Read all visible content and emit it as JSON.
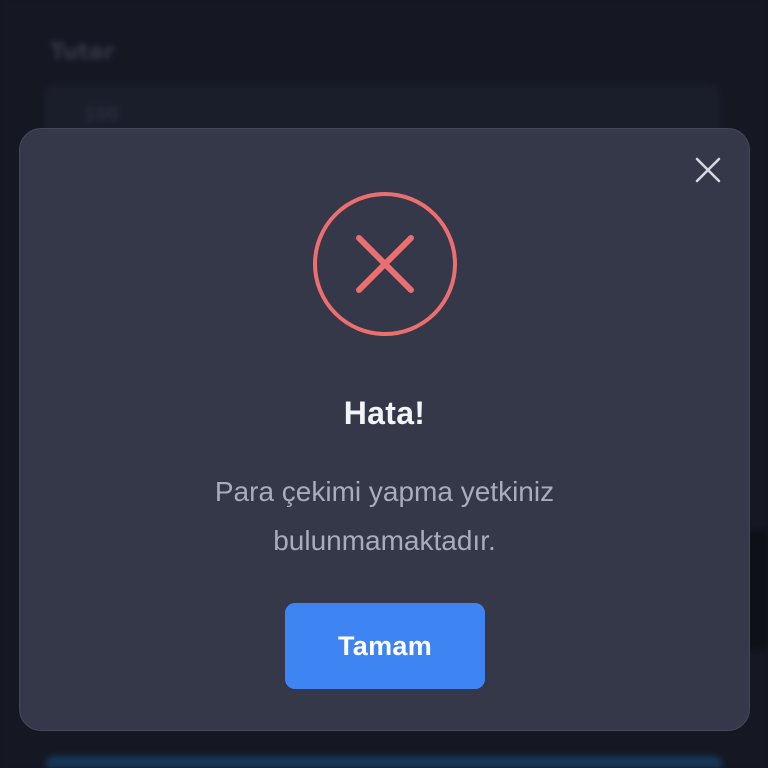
{
  "background": {
    "field_label": "Tutar",
    "field_value": "100"
  },
  "dialog": {
    "status_icon": "error-x-circle-icon",
    "close_icon": "close-x-icon",
    "title": "Hata!",
    "message": "Para çekimi yapma yetkiniz bulunmamaktadır.",
    "confirm_label": "Tamam"
  },
  "colors": {
    "dialog_bg": "#353849",
    "error": "#ec6f70",
    "primary": "#3e84f3",
    "title_text": "#f3f4f8",
    "message_text": "#a9abbe"
  }
}
